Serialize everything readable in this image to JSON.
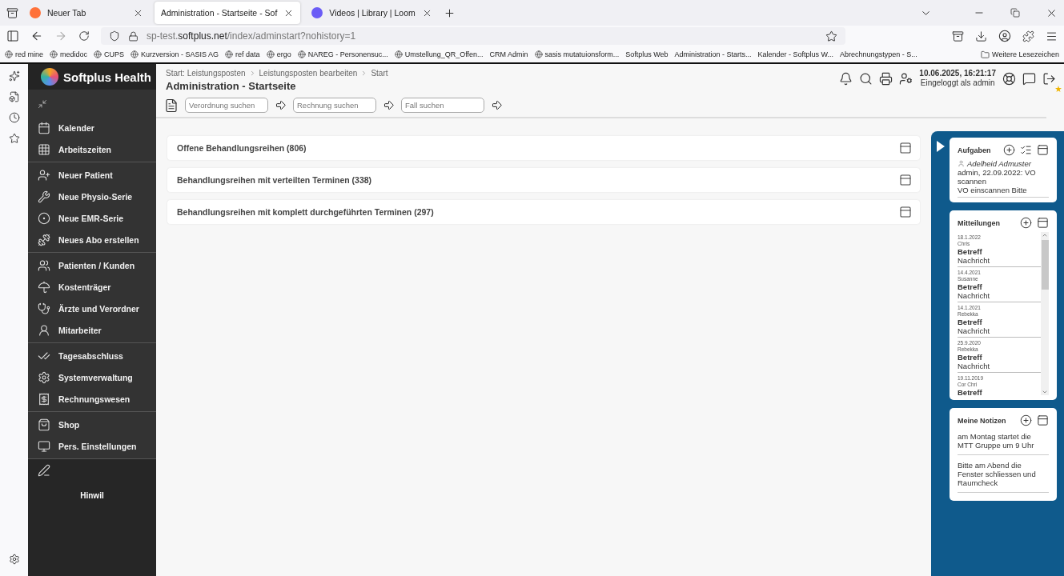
{
  "browser": {
    "tabs": [
      {
        "title": "Neuer Tab",
        "selected": false
      },
      {
        "title": "Administration - Startseite - Sof",
        "selected": true
      },
      {
        "title": "Videos | Library | Loom",
        "selected": false
      }
    ],
    "url": "sp-test.**softplus.net**/index/adminstart?nohistory=1",
    "bookmarks": [
      "red mine",
      "medidoc",
      "CUPS",
      "Kurzversion - SASIS AG",
      "ref data",
      "ergo",
      "NAREG - Personensuc...",
      "Umstellung_QR_Offen...",
      "CRM Admin",
      "sasis mutatuionsform...",
      "Softplus Web",
      "Administration - Starts...",
      "Kalender - Softplus W...",
      "Abrechnungstypen - S..."
    ],
    "other_bookmarks": "Weitere Lesezeichen"
  },
  "sidebar": {
    "brand": "Softplus Health",
    "groups": [
      [
        "Kalender",
        "Arbeitszeiten"
      ],
      [
        "Neuer Patient",
        "Neue Physio-Serie",
        "Neue EMR-Serie",
        "Neues Abo erstellen"
      ],
      [
        "Patienten / Kunden",
        "Kostenträger",
        "Ärzte und Verordner",
        "Mitarbeiter"
      ],
      [
        "Tagesabschluss",
        "Systemverwaltung",
        "Rechnungswesen"
      ],
      [
        "Shop",
        "Pers. Einstellungen"
      ]
    ],
    "location": "Hinwil"
  },
  "header": {
    "breadcrumbs": [
      "Start: Leistungsposten",
      "Leistungsposten bearbeiten",
      "Start"
    ],
    "title": "Administration - Startseite",
    "datetime": "10.06.2025, 16:21:17",
    "login": "Eingeloggt als admin"
  },
  "searches": [
    {
      "placeholder": "Verordnung suchen"
    },
    {
      "placeholder": "Rechnung suchen"
    },
    {
      "placeholder": "Fall suchen"
    }
  ],
  "panels": [
    "Offene Behandlungsreihen (806)",
    "Behandlungsreihen mit verteilten Terminen (338)",
    "Behandlungsreihen mit komplett durchgeführten Terminen (297)"
  ],
  "aufgaben": {
    "title": "Aufgaben",
    "tasks": [
      {
        "person": "Adelheid Admuster",
        "text": "admin, 22.09.2022: VO scannen",
        "note": "VO einscannen Bitte"
      }
    ]
  },
  "mitteilungen": {
    "title": "Mitteilungen",
    "messages": [
      {
        "date": "18.1.2022",
        "author": "Chris",
        "subject": "Betreff",
        "body": "Nachricht"
      },
      {
        "date": "14.4.2021",
        "author": "Susanne",
        "subject": "Betreff",
        "body": "Nachricht"
      },
      {
        "date": "14.1.2021",
        "author": "Rebekka",
        "subject": "Betreff",
        "body": "Nachricht"
      },
      {
        "date": "25.9.2020",
        "author": "Rebekka",
        "subject": "Betreff",
        "body": "Nachricht"
      },
      {
        "date": "19.11.2019",
        "author": "Cor Chri",
        "subject": "Betreff"
      }
    ]
  },
  "notizen": {
    "title": "Meine Notizen",
    "notes": [
      "am Montag startet die MTT Gruppe um 9 Uhr",
      "Bitte am Abend die Fenster schliessen und Raumcheck"
    ]
  }
}
